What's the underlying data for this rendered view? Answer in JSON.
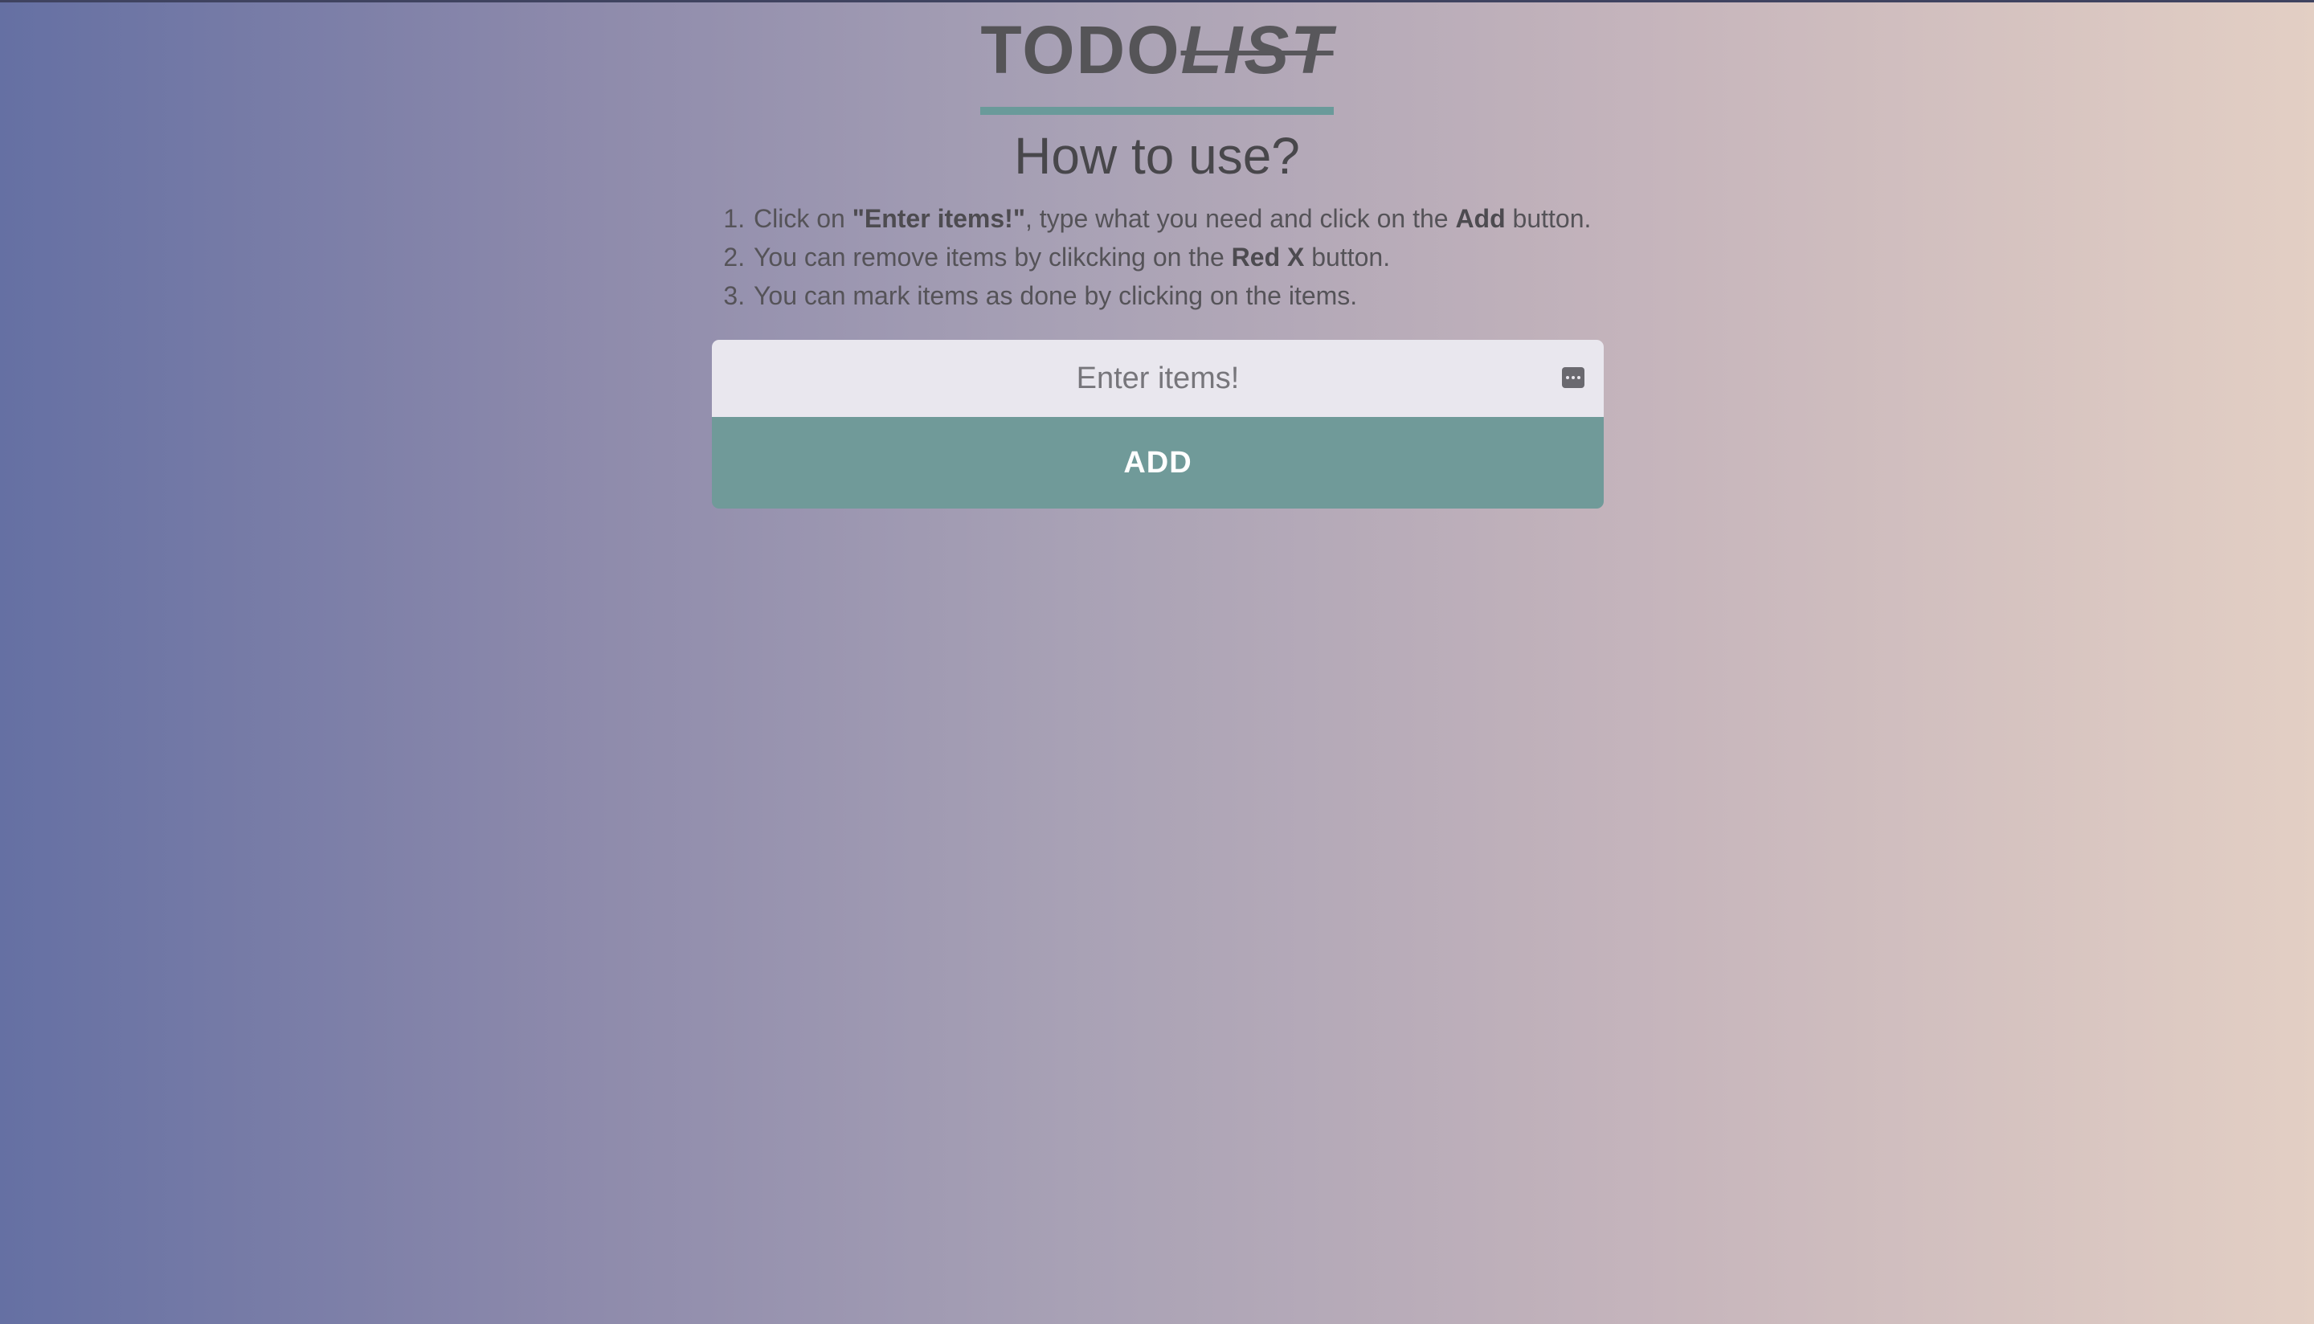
{
  "logo": {
    "part1": "TODO",
    "part2": "LIST"
  },
  "instructions": {
    "title": "How to use?",
    "steps": [
      {
        "before": "Click on ",
        "strong1": "\"Enter items!\"",
        "middle": ", type what you need and click on the ",
        "strong2": "Add",
        "after": " button."
      },
      {
        "before": "You can remove items by clikcking on the ",
        "strong1": "Red X",
        "after": " button."
      },
      {
        "text": "You can mark items as done by clicking on the items."
      }
    ]
  },
  "input": {
    "placeholder": "Enter items!",
    "value": ""
  },
  "add_button": {
    "label": "ADD"
  },
  "icons": {
    "input_trailing": "more-dots-icon"
  },
  "colors": {
    "accent": "#709a99",
    "underline": "#6a9a9a",
    "gradient_start": "#6570a3",
    "gradient_end": "#e3cfc4"
  }
}
